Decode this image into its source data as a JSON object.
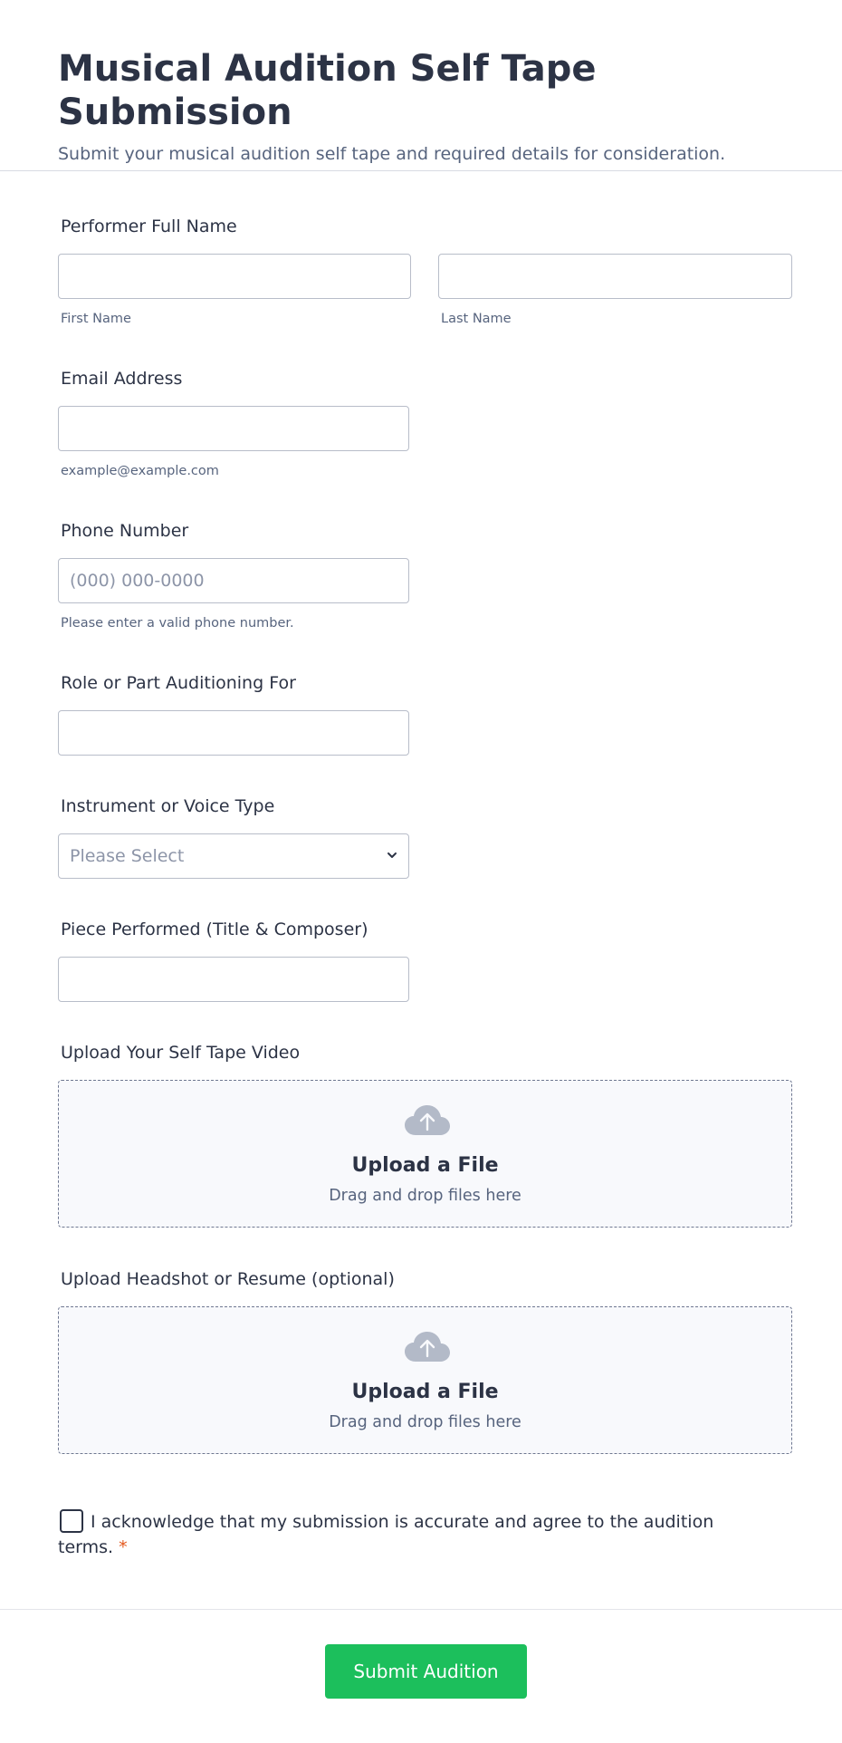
{
  "header": {
    "title": "Musical Audition Self Tape Submission",
    "subtitle": "Submit your musical audition self tape and required details for consideration."
  },
  "fields": {
    "full_name": {
      "label": "Performer Full Name",
      "first_sub": "First Name",
      "last_sub": "Last Name",
      "first_value": "",
      "last_value": ""
    },
    "email": {
      "label": "Email Address",
      "value": "",
      "sub": "example@example.com"
    },
    "phone": {
      "label": "Phone Number",
      "placeholder": "(000) 000-0000",
      "sub": "Please enter a valid phone number."
    },
    "role": {
      "label": "Role or Part Auditioning For",
      "value": ""
    },
    "instrument": {
      "label": "Instrument or Voice Type",
      "selected": "Please Select"
    },
    "piece": {
      "label": "Piece Performed (Title & Composer)",
      "value": ""
    }
  },
  "uploads": {
    "video": {
      "label": "Upload Your Self Tape Video",
      "title": "Upload a File",
      "hint": "Drag and drop files here",
      "icon": "cloud-upload-icon"
    },
    "headshot": {
      "label": "Upload Headshot or Resume (optional)",
      "title": "Upload a File",
      "hint": "Drag and drop files here",
      "icon": "cloud-upload-icon"
    }
  },
  "acknowledge": {
    "text": "I acknowledge that my submission is accurate and agree to the audition terms.",
    "required_mark": "*",
    "checked": false
  },
  "submit": {
    "label": "Submit Audition",
    "color": "#1cbf5c"
  }
}
